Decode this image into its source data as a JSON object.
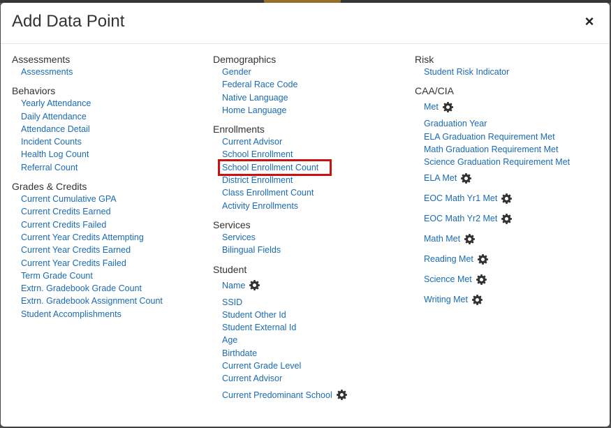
{
  "modal": {
    "title": "Add Data Point",
    "close_glyph": "×"
  },
  "columns": [
    {
      "sections": [
        {
          "title": "Assessments",
          "items": [
            "Assessments"
          ]
        },
        {
          "title": "Behaviors",
          "items": [
            "Yearly Attendance",
            "Daily Attendance",
            "Attendance Detail",
            "Incident Counts",
            "Health Log Count",
            "Referral Count"
          ]
        },
        {
          "title": "Grades & Credits",
          "items": [
            "Current Cumulative GPA",
            "Current Credits Earned",
            "Current Credits Failed",
            "Current Year Credits Attempting",
            "Current Year Credits Earned",
            "Current Year Credits Failed",
            "Term Grade Count",
            "Extrn. Gradebook Grade Count",
            "Extrn. Gradebook Assignment Count",
            "Student Accomplishments"
          ]
        }
      ]
    },
    {
      "sections": [
        {
          "title": "Demographics",
          "items": [
            "Gender",
            "Federal Race Code",
            "Native Language",
            "Home Language"
          ]
        },
        {
          "title": "Enrollments",
          "items": [
            "Current Advisor",
            "School Enrollment",
            "School Enrollment Count",
            "District Enrollment",
            "Class Enrollment Count",
            "Activity Enrollments"
          ]
        },
        {
          "title": "Services",
          "items": [
            "Services",
            "Bilingual Fields"
          ]
        },
        {
          "title": "Student",
          "items": [
            "Name",
            "SSID",
            "Student Other Id",
            "Student External Id",
            "Age",
            "Birthdate",
            "Current Grade Level",
            "Current Advisor",
            "Current Predominant School"
          ]
        }
      ]
    },
    {
      "sections": [
        {
          "title": "Risk",
          "items": [
            "Student Risk Indicator"
          ]
        },
        {
          "title": "CAA/CIA",
          "items": [
            "Met",
            "Graduation Year",
            "ELA Graduation Requirement Met",
            "Math Graduation Requirement Met",
            "Science Graduation Requirement Met",
            "ELA Met",
            "EOC Math Yr1 Met",
            "EOC Math Yr2 Met",
            "Math Met",
            "Reading Met",
            "Science Met",
            "Writing Met"
          ]
        }
      ]
    }
  ],
  "highlighted_item": "School Enrollment Count",
  "colors": {
    "link": "#1a6bb5",
    "highlight_border": "#cc1111",
    "title": "#333333"
  },
  "icons": {
    "settings": "gear-icon",
    "close": "close-icon"
  }
}
